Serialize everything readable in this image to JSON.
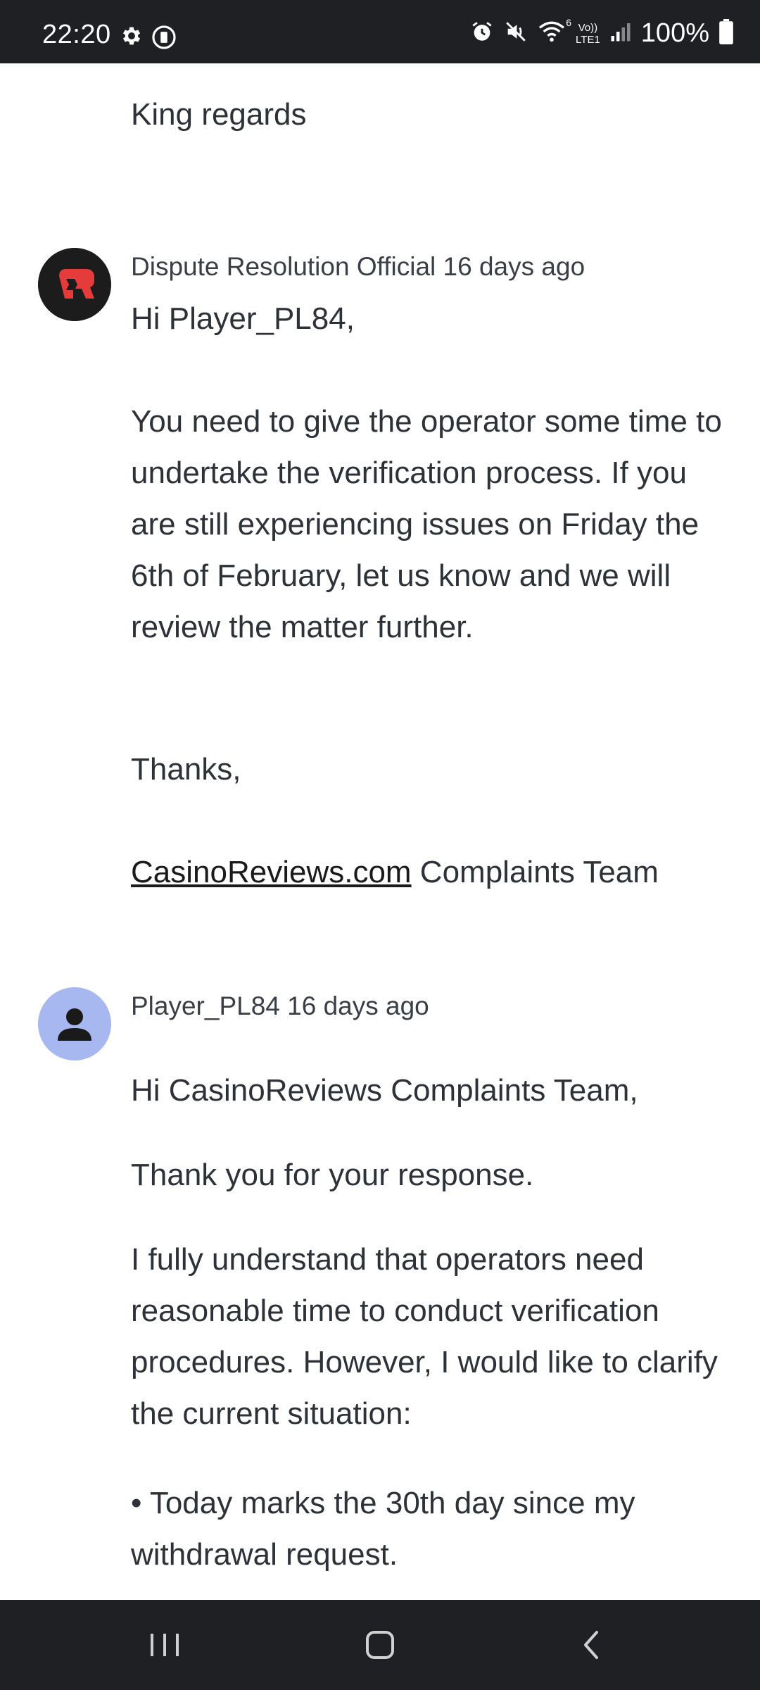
{
  "status_bar": {
    "time": "22:20",
    "battery": "100%",
    "icons": [
      "gear-icon",
      "data-saver-icon",
      "alarm-icon",
      "mute-icon",
      "wifi-icon",
      "volte-icon",
      "signal-icon",
      "battery-icon"
    ],
    "network_label_top": "Vo))",
    "network_label_bottom": "LTE1",
    "wifi_label": "6"
  },
  "thread": {
    "previous_message_tail": "King regards",
    "comments": [
      {
        "author": "Dispute Resolution Official",
        "time": "16 days ago",
        "avatar_icon": "casino-logo-icon",
        "greeting": "Hi Player_PL84,",
        "paragraphs": [
          "You need to give the operator some time to undertake the verification process. If you are still experiencing issues on Friday the 6th of February, let us know and we will review the matter further.",
          "Thanks,"
        ],
        "signature_link": "CasinoReviews.com",
        "signature_rest": " Complaints Team"
      },
      {
        "author": "Player_PL84",
        "time": "16 days ago",
        "avatar_icon": "person-icon",
        "paragraphs": [
          "Hi CasinoReviews Complaints Team,",
          "Thank you for your response.",
          "I fully understand that operators need reasonable time to conduct verification procedures. However, I would like to clarify the current situation:",
          "• Today marks the 30th day since my withdrawal request."
        ]
      }
    ]
  },
  "nav_bar": {
    "buttons": [
      "recents-icon",
      "home-icon",
      "back-icon"
    ]
  },
  "colors": {
    "system_bar": "#1f2024",
    "text": "#2d3138",
    "player_avatar_bg": "#a7b8f0",
    "official_avatar_bg": "#1c1c1c",
    "official_logo_red": "#e53b3b"
  }
}
